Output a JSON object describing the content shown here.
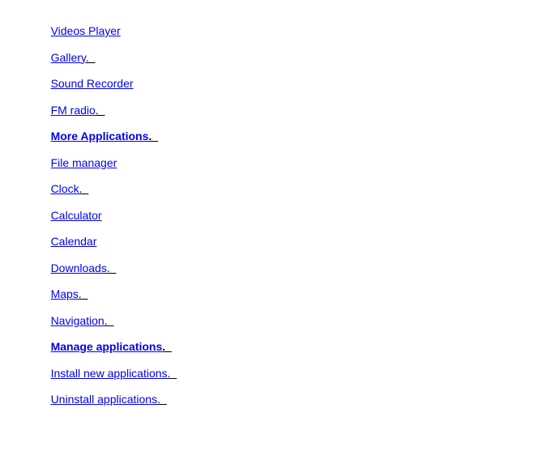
{
  "colors": {
    "link": "#0000ee",
    "suffix": "#000000",
    "background": "#ffffff"
  },
  "items": [
    {
      "label": "Videos Player",
      "suffix": "",
      "bold": false
    },
    {
      "label": "Gallery",
      "suffix": ".  ",
      "bold": false
    },
    {
      "label": "Sound Recorder",
      "suffix": "",
      "bold": false
    },
    {
      "label": "FM radio",
      "suffix": ".  ",
      "bold": false
    },
    {
      "label": "More Applications",
      "suffix": ".  ",
      "bold": true
    },
    {
      "label": "File manager",
      "suffix": "",
      "bold": false
    },
    {
      "label": "Clock",
      "suffix": ".  ",
      "bold": false
    },
    {
      "label": "Calculator",
      "suffix": "",
      "bold": false
    },
    {
      "label": "Calendar",
      "suffix": "",
      "bold": false
    },
    {
      "label": "Downloads",
      "suffix": ".  ",
      "bold": false
    },
    {
      "label": "Maps",
      "suffix": ".  ",
      "bold": false
    },
    {
      "label": "Navigation",
      "suffix": ".  ",
      "bold": false
    },
    {
      "label": "Manage applications",
      "suffix": ".  ",
      "bold": true
    },
    {
      "label": "Install new applications",
      "suffix": ".  ",
      "bold": false
    },
    {
      "label": "Uninstall applications",
      "suffix": ".  ",
      "bold": false
    }
  ]
}
